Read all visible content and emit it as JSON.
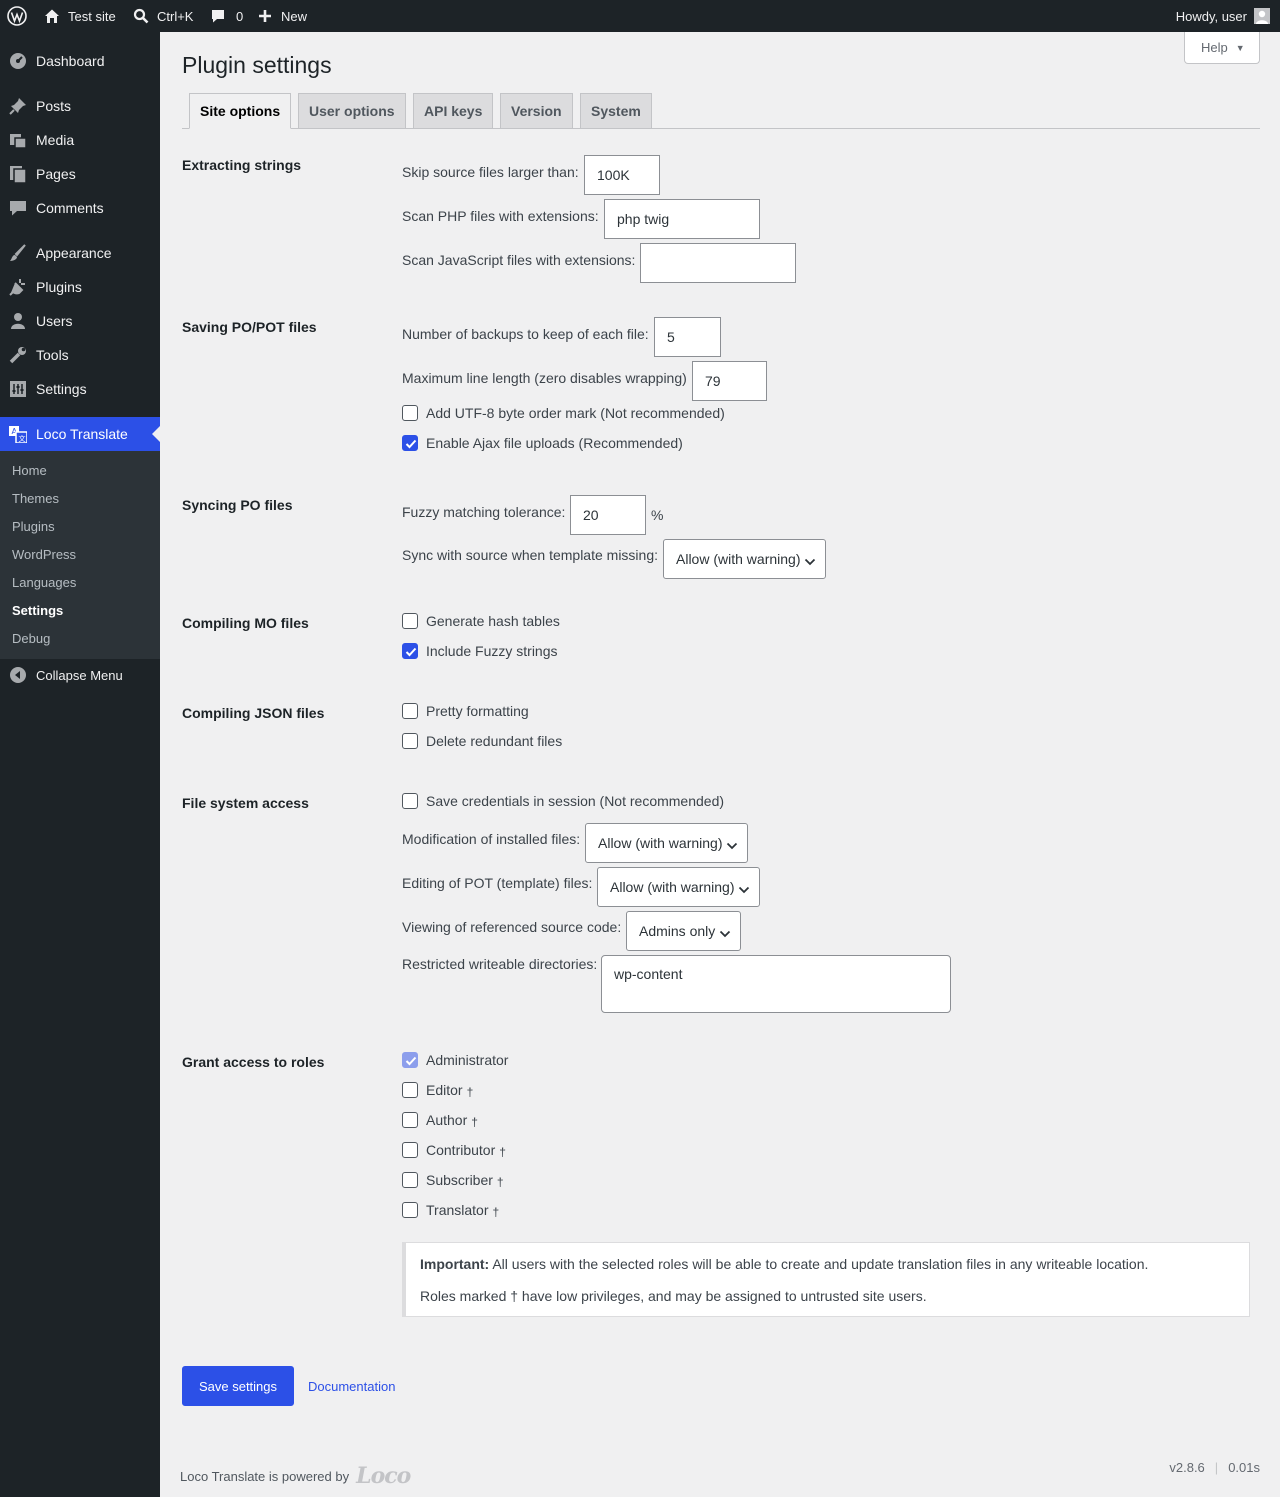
{
  "adminbar": {
    "site_name": "Test site",
    "search_shortcut": "Ctrl+K",
    "comments_count": "0",
    "new_label": "New",
    "howdy": "Howdy, user"
  },
  "sidebar": {
    "items": [
      {
        "label": "Dashboard",
        "icon": "dashboard-icon"
      },
      {
        "label": "Posts",
        "icon": "pin-icon"
      },
      {
        "label": "Media",
        "icon": "media-icon"
      },
      {
        "label": "Pages",
        "icon": "pages-icon"
      },
      {
        "label": "Comments",
        "icon": "comment-icon"
      },
      {
        "label": "Appearance",
        "icon": "brush-icon"
      },
      {
        "label": "Plugins",
        "icon": "plug-icon"
      },
      {
        "label": "Users",
        "icon": "user-icon"
      },
      {
        "label": "Tools",
        "icon": "wrench-icon"
      },
      {
        "label": "Settings",
        "icon": "sliders-icon"
      },
      {
        "label": "Loco Translate",
        "icon": "translate-icon"
      }
    ],
    "submenu": [
      "Home",
      "Themes",
      "Plugins",
      "WordPress",
      "Languages",
      "Settings",
      "Debug"
    ],
    "collapse_label": "Collapse Menu"
  },
  "page": {
    "help_label": "Help",
    "title": "Plugin settings",
    "tabs": [
      "Site options",
      "User options",
      "API keys",
      "Version",
      "System"
    ]
  },
  "sections": {
    "extracting": {
      "title": "Extracting strings",
      "skip_label": "Skip source files larger than:",
      "skip_value": "100K",
      "php_label": "Scan PHP files with extensions:",
      "php_value": "php twig",
      "js_label": "Scan JavaScript files with extensions:",
      "js_value": ""
    },
    "saving": {
      "title": "Saving PO/POT files",
      "backups_label": "Number of backups to keep of each file:",
      "backups_value": "5",
      "linelen_label": "Maximum line length (zero disables wrapping)",
      "linelen_value": "79",
      "bom_label": "Add UTF-8 byte order mark (Not recommended)",
      "bom_checked": false,
      "ajax_label": "Enable Ajax file uploads (Recommended)",
      "ajax_checked": true
    },
    "syncing": {
      "title": "Syncing PO files",
      "fuzzy_label": "Fuzzy matching tolerance:",
      "fuzzy_value": "20",
      "fuzzy_unit": "%",
      "sync_label": "Sync with source when template missing:",
      "sync_value": "Allow (with warning)"
    },
    "mo": {
      "title": "Compiling MO files",
      "hash_label": "Generate hash tables",
      "hash_checked": false,
      "fuzzy_label": "Include Fuzzy strings",
      "fuzzy_checked": true
    },
    "json": {
      "title": "Compiling JSON files",
      "pretty_label": "Pretty formatting",
      "pretty_checked": false,
      "redundant_label": "Delete redundant files",
      "redundant_checked": false
    },
    "fs": {
      "title": "File system access",
      "creds_label": "Save credentials in session (Not recommended)",
      "creds_checked": false,
      "mod_label": "Modification of installed files:",
      "mod_value": "Allow (with warning)",
      "pot_label": "Editing of POT (template) files:",
      "pot_value": "Allow (with warning)",
      "view_label": "Viewing of referenced source code:",
      "view_value": "Admins only",
      "dirs_label": "Restricted writeable directories:",
      "dirs_value": "wp-content"
    },
    "roles": {
      "title": "Grant access to roles",
      "items": [
        {
          "label": "Administrator",
          "checked": true,
          "dagger": ""
        },
        {
          "label": "Editor",
          "checked": false,
          "dagger": "†"
        },
        {
          "label": "Author",
          "checked": false,
          "dagger": "†"
        },
        {
          "label": "Contributor",
          "checked": false,
          "dagger": "†"
        },
        {
          "label": "Subscriber",
          "checked": false,
          "dagger": "†"
        },
        {
          "label": "Translator",
          "checked": false,
          "dagger": "†"
        }
      ],
      "notice_bold": "Important:",
      "notice_line1": "All users with the selected roles will be able to create and update translation files in any writeable location.",
      "notice_line2": "Roles marked † have low privileges, and may be assigned to untrusted site users."
    }
  },
  "actions": {
    "save_label": "Save settings",
    "doc_label": "Documentation"
  },
  "footer": {
    "powered_text": "Loco Translate is powered by",
    "logo_text": "Loco",
    "version": "v2.8.6",
    "time": "0.01s"
  },
  "colors": {
    "accent": "#2c50e7",
    "adminbar_bg": "#1d2327",
    "page_bg": "#f0f0f1"
  }
}
